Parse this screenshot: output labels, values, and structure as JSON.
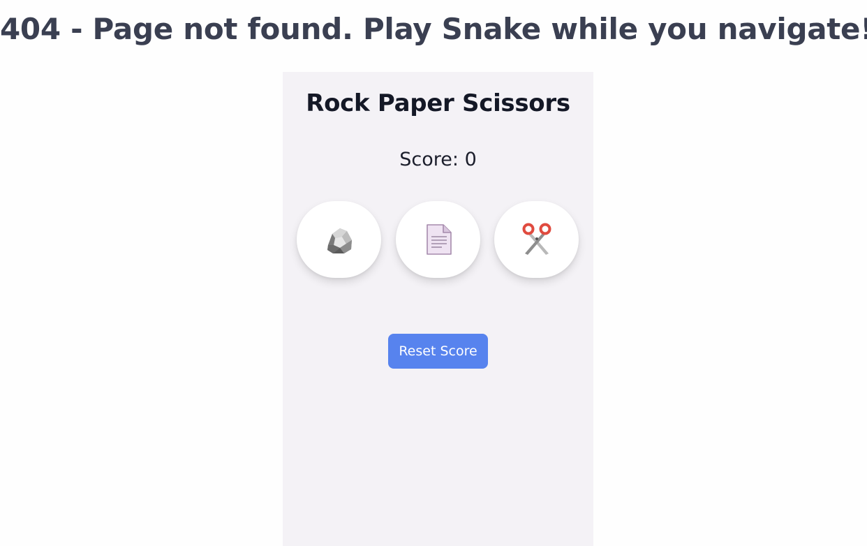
{
  "page": {
    "headline": "404 - Page not found. Play Snake while you navigate!"
  },
  "game": {
    "title": "Rock Paper Scissors",
    "score_label": "Score:",
    "score_value": 0,
    "choices": [
      {
        "id": "rock",
        "icon": "rock-icon"
      },
      {
        "id": "paper",
        "icon": "paper-icon"
      },
      {
        "id": "scissors",
        "icon": "scissors-icon"
      }
    ],
    "reset_label": "Reset Score"
  },
  "colors": {
    "headline": "#3a3f51",
    "panel_background": "#f4f2f6",
    "button_accent": "#5783ee",
    "scissors_handle": "#e04b3f"
  }
}
